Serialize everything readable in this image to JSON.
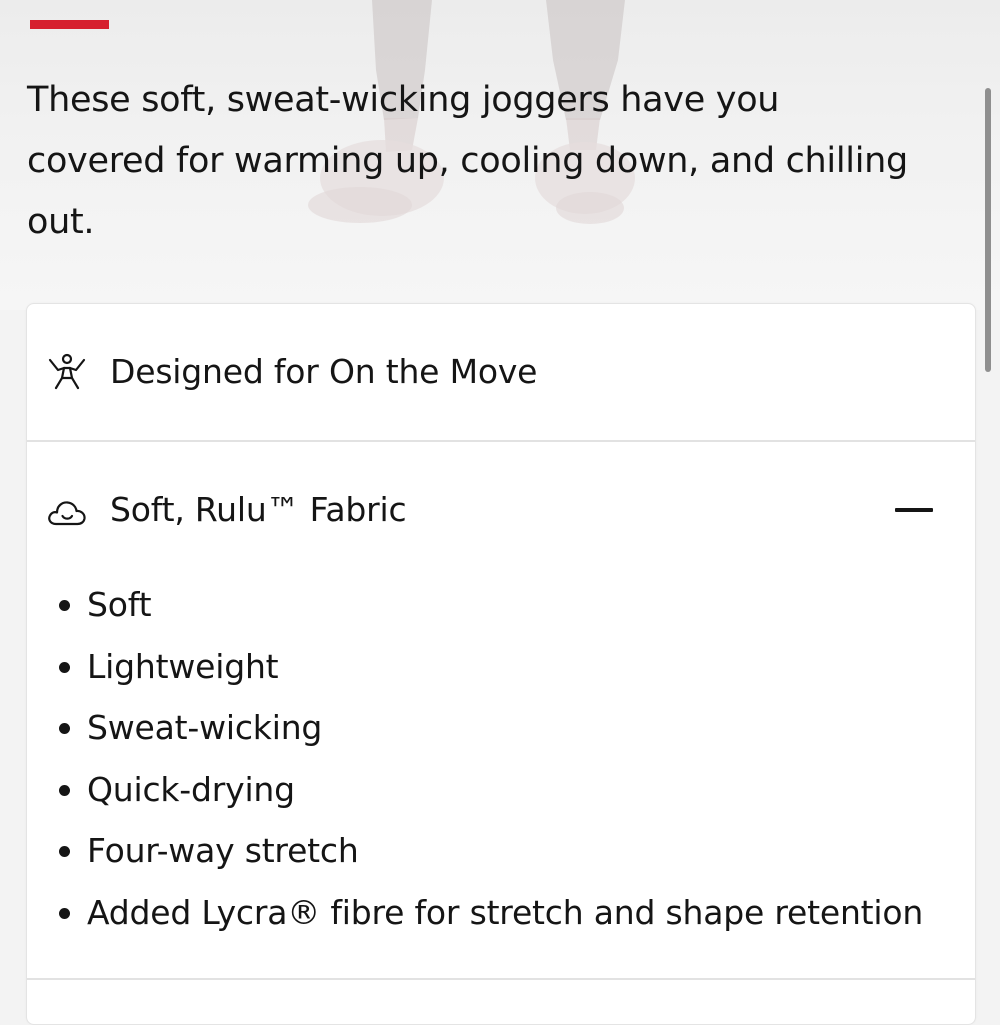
{
  "colors": {
    "accent": "#d6202f",
    "text": "#151515",
    "divider": "#e2e2e2",
    "card_bg": "#ffffff",
    "page_bg": "#f3f3f3"
  },
  "description": "These soft, sweat-wicking joggers have you covered for warming up, cooling down, and chilling out.",
  "details": {
    "sections": [
      {
        "icon": "person-stretching-icon",
        "title": "Designed for On the Move",
        "expanded": false
      },
      {
        "icon": "cloud-icon",
        "title": "Soft, Rulu™ Fabric",
        "expanded": true,
        "toggle_icon": "minus-icon",
        "features": [
          "Soft",
          "Lightweight",
          "Sweat-wicking",
          "Quick-drying",
          "Four-way stretch",
          "Added Lycra® fibre for stretch and shape retention"
        ]
      }
    ]
  }
}
